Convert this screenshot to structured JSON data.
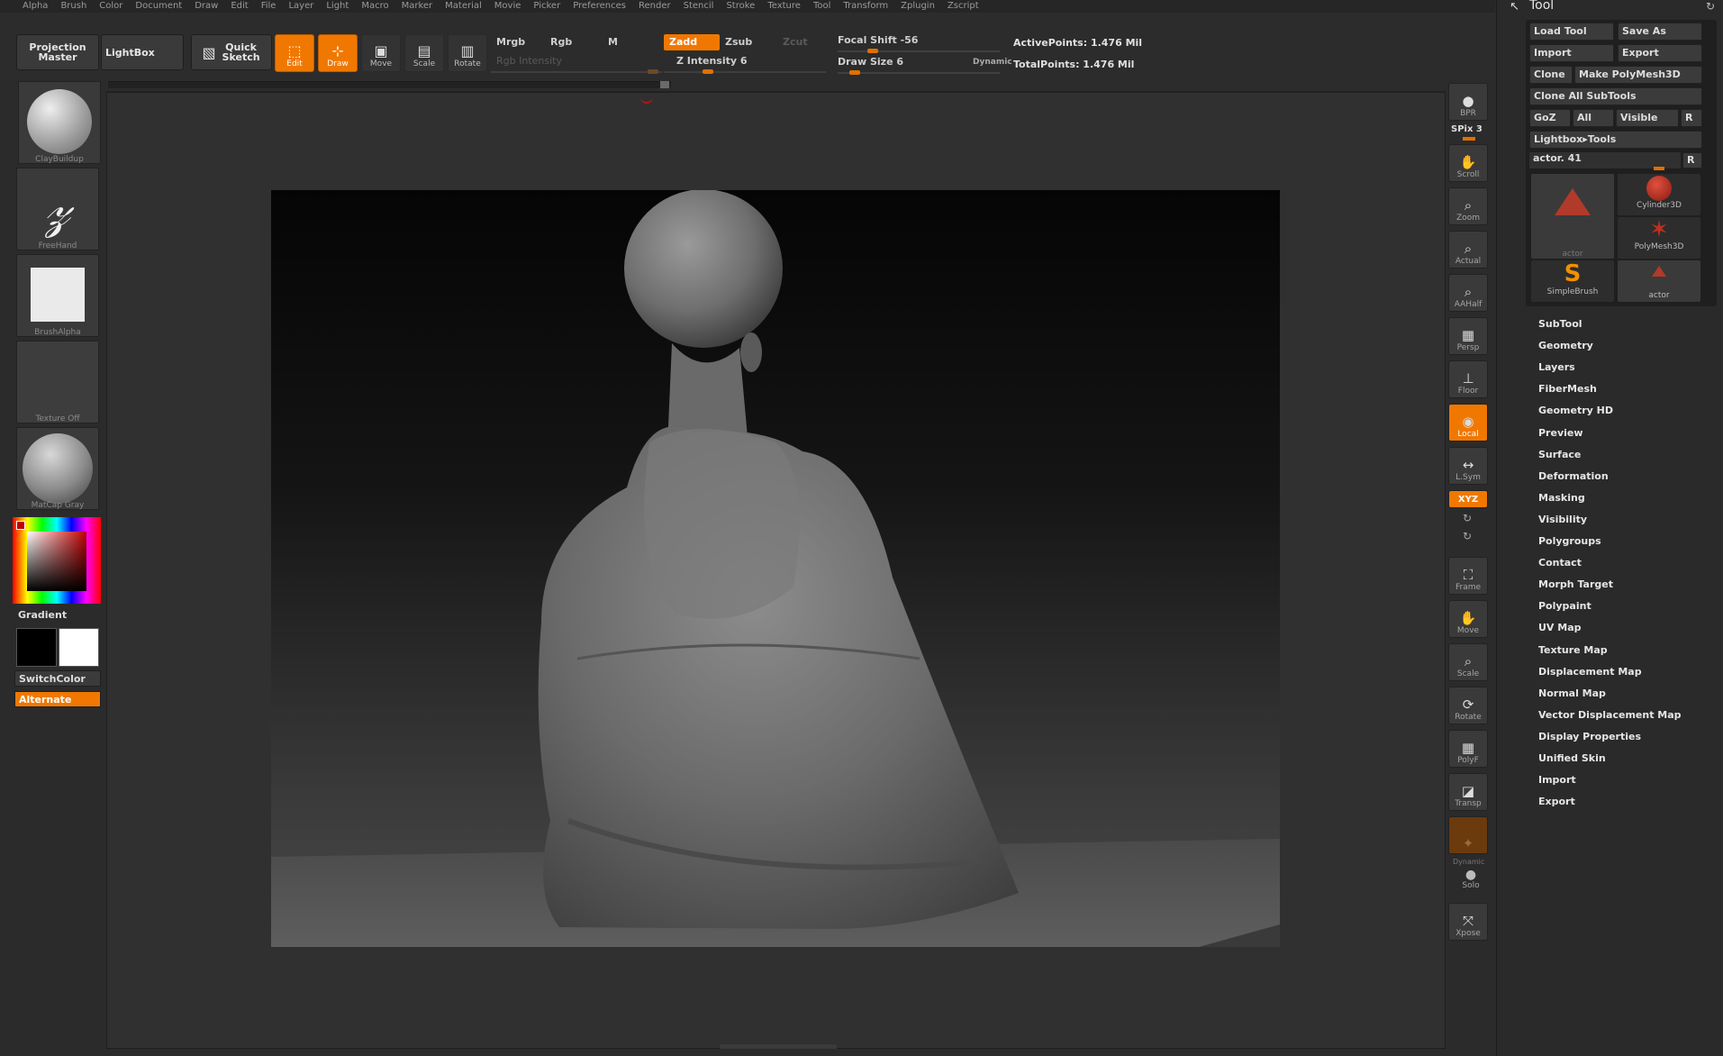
{
  "menubar": [
    "Alpha",
    "Brush",
    "Color",
    "Document",
    "Draw",
    "Edit",
    "File",
    "Layer",
    "Light",
    "Macro",
    "Marker",
    "Material",
    "Movie",
    "Picker",
    "Preferences",
    "Render",
    "Stencil",
    "Stroke",
    "Texture",
    "Tool",
    "Transform",
    "Zplugin",
    "Zscript"
  ],
  "top": {
    "projection_master": "Projection Master",
    "lightbox": "LightBox",
    "quick_sketch": "Quick Sketch",
    "tools": [
      {
        "label": "Edit",
        "icon": "edit-icon",
        "active": true
      },
      {
        "label": "Draw",
        "icon": "draw-icon",
        "active": true
      },
      {
        "label": "Move",
        "icon": "move-icon",
        "active": false
      },
      {
        "label": "Scale",
        "icon": "scale-icon",
        "active": false
      },
      {
        "label": "Rotate",
        "icon": "rotate-icon",
        "active": false
      }
    ],
    "mrgb": "Mrgb",
    "rgb": "Rgb",
    "m": "M",
    "rgb_intensity": "Rgb Intensity",
    "zadd": "Zadd",
    "zsub": "Zsub",
    "zcut": "Zcut",
    "z_intensity": "Z Intensity 6",
    "focal_shift": "Focal Shift -56",
    "draw_size": "Draw Size 6",
    "dynamic": "Dynamic",
    "active_points": "ActivePoints: 1.476 Mil",
    "total_points": "TotalPoints: 1.476 Mil"
  },
  "left": {
    "brush": "ClayBuildup",
    "stroke": "FreeHand",
    "alpha": "BrushAlpha",
    "texture": "Texture Off",
    "material": "MatCap Gray",
    "gradient": "Gradient",
    "switch_color": "SwitchColor",
    "alternate": "Alternate"
  },
  "right": {
    "spix": "SPix 3",
    "buttons": [
      {
        "label": "BPR",
        "icon": "render-sphere-icon"
      },
      {
        "label": "Scroll",
        "icon": "scroll-hand-icon"
      },
      {
        "label": "Zoom",
        "icon": "zoom-icon"
      },
      {
        "label": "Actual",
        "icon": "actual-icon"
      },
      {
        "label": "AAHalf",
        "icon": "aahalf-icon"
      },
      {
        "label": "Persp",
        "icon": "perspective-icon"
      },
      {
        "label": "Floor",
        "icon": "floor-icon"
      },
      {
        "label": "Local",
        "icon": "local-icon"
      },
      {
        "label": "L.Sym",
        "icon": "local-symmetry-icon"
      },
      {
        "label": "XYZ",
        "icon": "xyz-icon"
      },
      {
        "label": "Frame",
        "icon": "frame-icon"
      },
      {
        "label": "Move",
        "icon": "move-hand-icon"
      },
      {
        "label": "Scale",
        "icon": "scale-icon"
      },
      {
        "label": "Rotate",
        "icon": "rotate-icon"
      },
      {
        "label": "PolyF",
        "icon": "polyframe-icon"
      },
      {
        "label": "Transp",
        "icon": "transparency-icon"
      },
      {
        "label": "Dynamic",
        "icon": "ghost-icon"
      },
      {
        "label": "Solo",
        "icon": "solo-icon"
      },
      {
        "label": "Xpose",
        "icon": "xpose-icon"
      }
    ]
  },
  "toolpanel": {
    "title": "Tool",
    "load_tool": "Load Tool",
    "save_as": "Save As",
    "import": "Import",
    "export": "Export",
    "clone": "Clone",
    "make_polymesh": "Make PolyMesh3D",
    "clone_all": "Clone All SubTools",
    "goz": "GoZ",
    "all": "All",
    "visible": "Visible",
    "r": "R",
    "lightbox_tools": "Lightbox▸Tools",
    "current_tool": "actor. 41",
    "thumbnails": [
      {
        "label": "actor"
      },
      {
        "label": "Cylinder3D"
      },
      {
        "label": "PolyMesh3D"
      },
      {
        "label": "SimpleBrush"
      },
      {
        "label": "actor"
      }
    ],
    "sections": [
      "SubTool",
      "Geometry",
      "Layers",
      "FiberMesh",
      "Geometry HD",
      "Preview",
      "Surface",
      "Deformation",
      "Masking",
      "Visibility",
      "Polygroups",
      "Contact",
      "Morph Target",
      "Polypaint",
      "UV Map",
      "Texture Map",
      "Displacement Map",
      "Normal Map",
      "Vector Displacement Map",
      "Display Properties",
      "Unified Skin",
      "Import",
      "Export"
    ]
  },
  "colors": {
    "accent": "#f07800",
    "panel": "#2b2b2b",
    "button": "#3a3a3a"
  }
}
